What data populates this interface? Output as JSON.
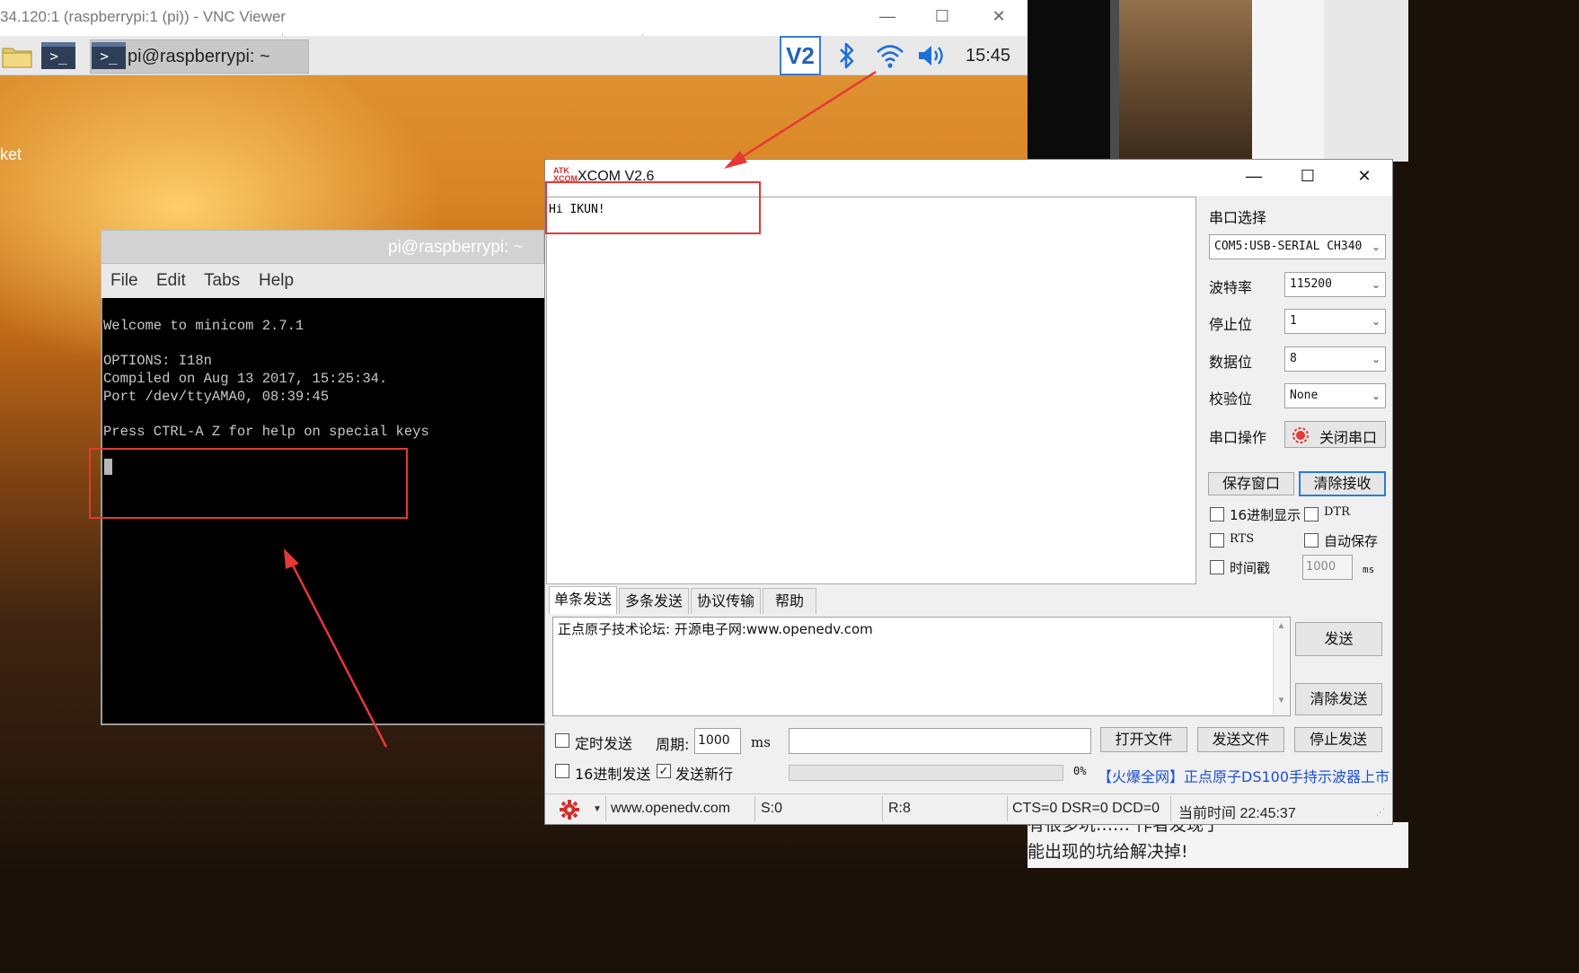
{
  "vnc": {
    "title": "34.120:1 (raspberrypi:1 (pi)) - VNC Viewer",
    "minimize": "—",
    "maximize": "☐",
    "close": "✕"
  },
  "rpi_panel": {
    "taskbar_item": "pi@raspberrypi: ~",
    "vnc_tray": "V2",
    "clock": "15:45"
  },
  "desktop": {
    "edge_label": "ket"
  },
  "terminal": {
    "title": "pi@raspberrypi: ~",
    "menu": [
      "File",
      "Edit",
      "Tabs",
      "Help"
    ],
    "lines": [
      "Welcome to minicom 2.7.1",
      "OPTIONS: I18n",
      "Compiled on Aug 13 2017, 15:25:34.",
      "Port /dev/ttyAMA0, 08:39:45",
      "Press CTRL-A Z for help on special keys"
    ]
  },
  "xcom": {
    "title": "XCOM V2.6",
    "logo": "ATK XCOM",
    "received_text": "Hi IKUN!",
    "port_select_label": "串口选择",
    "port_value": "COM5:USB-SERIAL CH340",
    "baud_label": "波特率",
    "baud_value": "115200",
    "stop_label": "停止位",
    "stop_value": "1",
    "data_label": "数据位",
    "data_value": "8",
    "parity_label": "校验位",
    "parity_value": "None",
    "op_label": "串口操作",
    "close_port": "关闭串口",
    "save_window": "保存窗口",
    "clear_recv": "清除接收",
    "hex_display": "16进制显示",
    "dtr": "DTR",
    "rts": "RTS",
    "auto_save": "自动保存",
    "timestamp": "时间戳",
    "timestamp_value": "1000",
    "ms": "ms",
    "tabs": [
      "单条发送",
      "多条发送",
      "协议传输",
      "帮助"
    ],
    "send_text": "正点原子技术论坛: 开源电子网:www.openedv.com",
    "send": "发送",
    "clear_send": "清除发送",
    "timed_send": "定时发送",
    "period_label": "周期:",
    "period_value": "1000",
    "open_file": "打开文件",
    "send_file": "发送文件",
    "stop_send": "停止发送",
    "hex_send": "16进制发送",
    "send_newline": "发送新行",
    "progress_percent": "0%",
    "ad_link": "【火爆全网】正点原子DS100手持示波器上市",
    "status": {
      "url": "www.openedv.com",
      "sent": "S:0",
      "recv": "R:8",
      "lines": "CTS=0 DSR=0 DCD=0",
      "time": "当前时间 22:45:37"
    }
  },
  "background_doc": {
    "line1": "有很多坑…… 作者发现了",
    "line2": "能出现的坑给解决掉!"
  },
  "colors": {
    "annotation_red": "#e53935",
    "accent_blue": "#2a7bd6",
    "link_blue": "#1a4fd6"
  }
}
